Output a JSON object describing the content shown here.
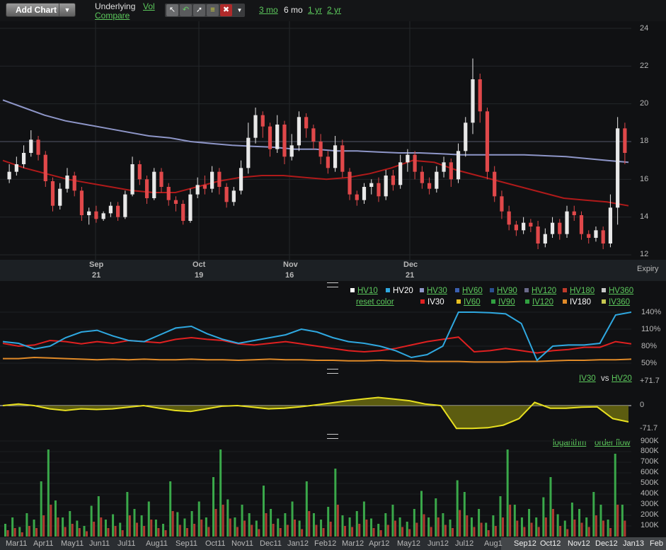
{
  "toolbar": {
    "add_chart": "Add Chart",
    "underlying": "Underlying",
    "vol": "Vol",
    "compare": "Compare",
    "ranges": [
      "3 mo",
      "6 mo",
      "1 yr",
      "2 yr"
    ],
    "active_range": "6 mo",
    "tools": [
      "pointer-icon",
      "undo-icon",
      "line-draw-icon",
      "studies-icon",
      "delete-icon",
      "dropdown-icon"
    ]
  },
  "colors": {
    "up": "#e8e8e8",
    "down": "#e0484a",
    "ma_long": "#8e96c8",
    "ma_short": "#b01a1a",
    "hv20": "#2fa8e0",
    "iv30": "#e02020",
    "iv180": "#e08a28",
    "spread": "#e8e020",
    "vol_green": "#3aa84a",
    "vol_red": "#b03a30",
    "link": "#5cc85c"
  },
  "price_panel": {
    "y_ticks": [
      "24",
      "22",
      "20",
      "18",
      "16",
      "14",
      "12"
    ],
    "months": [
      {
        "m": "Sep",
        "d": "21"
      },
      {
        "m": "Oct",
        "d": "19"
      },
      {
        "m": "Nov",
        "d": "16"
      },
      {
        "m": "Dec",
        "d": "21"
      }
    ],
    "expiry_label": "Expiry"
  },
  "vol_panel": {
    "legend_row1": [
      {
        "label": "HV10",
        "color": "#ffffff",
        "active": false
      },
      {
        "label": "HV20",
        "color": "#2fa8e0",
        "active": true
      },
      {
        "label": "HV30",
        "color": "#8e96c8",
        "active": false
      },
      {
        "label": "HV60",
        "color": "#3a5fb0",
        "active": false
      },
      {
        "label": "HV90",
        "color": "#2a4f90",
        "active": false
      },
      {
        "label": "HV120",
        "color": "#6a6a8a",
        "active": false
      },
      {
        "label": "HV180",
        "color": "#c03a2a",
        "active": false
      },
      {
        "label": "HV360",
        "color": "#c8c8c8",
        "active": false
      }
    ],
    "legend_row2": [
      {
        "label": "reset color",
        "color": "",
        "active": false
      },
      {
        "label": "IV30",
        "color": "#e02020",
        "active": true
      },
      {
        "label": "IV60",
        "color": "#e8c020",
        "active": false
      },
      {
        "label": "IV90",
        "color": "#30a040",
        "active": false
      },
      {
        "label": "IV120",
        "color": "#30a040",
        "active": false
      },
      {
        "label": "IV180",
        "color": "#e08a28",
        "active": true
      },
      {
        "label": "IV360",
        "color": "#c8c850",
        "active": false
      }
    ],
    "y_ticks": [
      "140%",
      "110%",
      "80%",
      "50%"
    ]
  },
  "spread_panel": {
    "legend_a": "IV30",
    "legend_vs": "vs",
    "legend_b": "HV20",
    "y_ticks": [
      "+71.7",
      "0",
      "-71.7"
    ]
  },
  "volume_panel": {
    "links": [
      "logarithm",
      "order flow"
    ],
    "y_ticks": [
      "900K",
      "800K",
      "700K",
      "600K",
      "500K",
      "400K",
      "300K",
      "200K",
      "100K"
    ]
  },
  "bottom_axis": {
    "labels": [
      "Mar11",
      "Apr11",
      "May11",
      "Jun11",
      "Jul11",
      "Aug11",
      "Sep11",
      "Oct11",
      "Nov11",
      "Dec11",
      "Jan12",
      "Feb12",
      "Mar12",
      "Apr12",
      "May12",
      "Jun12",
      "Jul12",
      "Aug1",
      "Sep12",
      "Oct12",
      "Nov12",
      "Dec12",
      "Jan13",
      "Feb"
    ]
  },
  "chart_data": {
    "type": "candlestick",
    "y_range": [
      12,
      24
    ],
    "ma_long": [
      20.2,
      19.8,
      19.4,
      19.1,
      18.9,
      18.7,
      18.5,
      18.3,
      18.2,
      18.0,
      17.9,
      17.8,
      17.75,
      17.7,
      17.6,
      17.6,
      17.5,
      17.5,
      17.45,
      17.4,
      17.4,
      17.35,
      17.3,
      17.3,
      17.3,
      17.3,
      17.25,
      17.2,
      17.1,
      17.0,
      16.9
    ],
    "ma_short": [
      17.0,
      16.6,
      16.3,
      16.0,
      15.8,
      15.6,
      15.4,
      15.3,
      15.3,
      15.6,
      15.9,
      16.1,
      16.2,
      16.2,
      16.1,
      16.0,
      16.1,
      16.3,
      16.6,
      17.0,
      16.9,
      16.5,
      16.2,
      15.9,
      15.6,
      15.3,
      15.0,
      14.9,
      14.8,
      14.6
    ],
    "candles": [
      [
        16.0,
        16.4,
        15.8,
        16.8
      ],
      [
        16.4,
        16.8,
        16.2,
        17.2
      ],
      [
        16.8,
        17.4,
        16.6,
        17.8
      ],
      [
        17.4,
        18.1,
        17.2,
        18.6
      ],
      [
        18.1,
        17.3,
        17.0,
        18.3
      ],
      [
        17.3,
        15.9,
        15.6,
        17.5
      ],
      [
        15.9,
        14.6,
        14.3,
        16.1
      ],
      [
        14.6,
        15.5,
        14.4,
        15.8
      ],
      [
        15.5,
        16.2,
        15.3,
        16.6
      ],
      [
        16.2,
        15.4,
        15.1,
        16.4
      ],
      [
        15.4,
        14.1,
        13.8,
        15.6
      ],
      [
        14.1,
        14.3,
        13.6,
        14.5
      ],
      [
        14.3,
        13.9,
        13.7,
        14.6
      ],
      [
        13.9,
        14.2,
        13.8,
        14.3
      ],
      [
        14.2,
        14.6,
        14.0,
        14.8
      ],
      [
        14.6,
        14.0,
        13.8,
        14.8
      ],
      [
        14.0,
        15.2,
        13.9,
        15.4
      ],
      [
        15.2,
        16.8,
        15.1,
        17.2
      ],
      [
        16.8,
        16.0,
        15.7,
        17.0
      ],
      [
        16.0,
        15.0,
        14.7,
        16.2
      ],
      [
        15.0,
        16.4,
        14.9,
        16.6
      ],
      [
        16.4,
        15.6,
        15.3,
        16.6
      ],
      [
        15.6,
        14.9,
        14.6,
        15.8
      ],
      [
        14.9,
        14.7,
        14.3,
        15.1
      ],
      [
        14.7,
        13.8,
        13.6,
        14.9
      ],
      [
        13.8,
        15.2,
        13.7,
        15.5
      ],
      [
        15.2,
        15.7,
        15.0,
        16.1
      ],
      [
        15.7,
        15.5,
        15.2,
        16.2
      ],
      [
        15.5,
        16.4,
        15.3,
        16.7
      ],
      [
        16.4,
        15.6,
        15.2,
        16.6
      ],
      [
        15.6,
        14.8,
        14.5,
        15.8
      ],
      [
        14.8,
        15.4,
        14.6,
        15.6
      ],
      [
        15.4,
        16.6,
        15.2,
        17.0
      ],
      [
        16.6,
        18.2,
        16.3,
        19.0
      ],
      [
        18.2,
        19.4,
        17.9,
        19.8
      ],
      [
        19.4,
        18.8,
        18.2,
        19.6
      ],
      [
        18.8,
        17.6,
        17.2,
        19.0
      ],
      [
        17.6,
        18.9,
        17.4,
        19.4
      ],
      [
        18.9,
        17.2,
        16.8,
        19.1
      ],
      [
        17.2,
        17.8,
        17.0,
        18.4
      ],
      [
        17.8,
        19.3,
        17.5,
        19.6
      ],
      [
        19.3,
        18.7,
        18.2,
        19.5
      ],
      [
        18.7,
        18.0,
        17.6,
        18.9
      ],
      [
        18.0,
        17.2,
        16.8,
        18.4
      ],
      [
        17.2,
        16.6,
        16.3,
        17.5
      ],
      [
        16.6,
        17.8,
        16.4,
        18.3
      ],
      [
        17.8,
        16.4,
        16.1,
        18.1
      ],
      [
        16.4,
        15.2,
        14.9,
        16.6
      ],
      [
        15.2,
        14.9,
        14.6,
        15.4
      ],
      [
        14.9,
        15.6,
        14.7,
        15.8
      ],
      [
        15.6,
        15.8,
        15.2,
        16.0
      ],
      [
        15.8,
        15.1,
        14.8,
        16.1
      ],
      [
        15.1,
        16.2,
        14.9,
        16.5
      ],
      [
        16.2,
        15.7,
        15.4,
        16.5
      ],
      [
        15.7,
        16.9,
        15.5,
        17.3
      ],
      [
        16.9,
        17.3,
        16.4,
        17.6
      ],
      [
        17.3,
        16.4,
        16.0,
        17.5
      ],
      [
        16.4,
        15.8,
        15.5,
        16.7
      ],
      [
        15.8,
        15.5,
        15.2,
        16.1
      ],
      [
        15.5,
        16.4,
        15.3,
        16.7
      ],
      [
        16.4,
        16.9,
        16.1,
        17.2
      ],
      [
        16.9,
        16.0,
        15.6,
        17.1
      ],
      [
        16.0,
        17.5,
        15.8,
        17.9
      ],
      [
        17.5,
        19.0,
        17.2,
        19.3
      ],
      [
        19.0,
        21.3,
        18.4,
        22.4
      ],
      [
        21.3,
        19.6,
        19.0,
        21.6
      ],
      [
        19.6,
        16.4,
        16.0,
        19.8
      ],
      [
        16.4,
        15.1,
        14.8,
        16.7
      ],
      [
        15.1,
        14.3,
        13.9,
        15.4
      ],
      [
        14.3,
        13.6,
        13.3,
        14.6
      ],
      [
        13.6,
        13.3,
        13.0,
        13.8
      ],
      [
        13.3,
        13.7,
        13.1,
        14.0
      ],
      [
        13.7,
        13.5,
        13.2,
        13.9
      ],
      [
        13.5,
        12.6,
        12.3,
        13.8
      ],
      [
        12.6,
        13.1,
        12.4,
        13.4
      ],
      [
        13.1,
        13.7,
        12.9,
        14.0
      ],
      [
        13.7,
        13.1,
        12.8,
        13.9
      ],
      [
        13.1,
        14.3,
        12.9,
        14.6
      ],
      [
        14.3,
        14.1,
        13.8,
        14.6
      ],
      [
        14.1,
        13.1,
        12.8,
        14.3
      ],
      [
        13.1,
        12.9,
        12.6,
        13.3
      ],
      [
        12.9,
        13.3,
        12.7,
        13.5
      ],
      [
        13.3,
        12.6,
        12.3,
        13.5
      ],
      [
        12.6,
        14.5,
        12.4,
        15.2
      ],
      [
        14.5,
        18.7,
        13.6,
        19.3
      ],
      [
        18.7,
        17.4,
        16.8,
        19.0
      ]
    ],
    "vol_hv20": [
      88,
      85,
      75,
      80,
      95,
      105,
      108,
      98,
      90,
      88,
      100,
      112,
      115,
      102,
      92,
      85,
      90,
      95,
      100,
      110,
      105,
      95,
      88,
      85,
      80,
      72,
      60,
      65,
      80,
      140,
      140,
      139,
      137,
      120,
      55,
      80,
      82,
      82,
      85,
      135,
      140
    ],
    "vol_iv30": [
      85,
      80,
      82,
      90,
      88,
      84,
      88,
      85,
      90,
      88,
      86,
      92,
      95,
      92,
      90,
      84,
      82,
      85,
      88,
      84,
      80,
      76,
      72,
      70,
      72,
      76,
      82,
      88,
      92,
      96,
      70,
      72,
      76,
      72,
      68,
      72,
      74,
      78,
      78,
      88,
      84
    ],
    "vol_iv180": [
      58,
      58,
      60,
      59,
      58,
      57,
      56,
      57,
      56,
      57,
      56,
      56,
      57,
      56,
      56,
      55,
      56,
      57,
      56,
      56,
      55,
      55,
      54,
      54,
      55,
      54,
      54,
      53,
      53,
      53,
      52,
      52,
      52,
      53,
      53,
      54,
      55,
      55,
      56,
      56,
      57
    ],
    "spread": [
      0,
      5,
      0,
      -10,
      -15,
      -10,
      -12,
      -10,
      -5,
      0,
      -8,
      -15,
      -18,
      -10,
      -2,
      0,
      -5,
      -10,
      -8,
      -4,
      2,
      8,
      15,
      20,
      25,
      20,
      15,
      5,
      0,
      -70,
      -70,
      -68,
      -60,
      -40,
      10,
      -8,
      -8,
      -5,
      -4,
      -40,
      -50
    ],
    "volume_green": [
      120,
      180,
      90,
      220,
      160,
      520,
      820,
      340,
      180,
      240,
      150,
      100,
      290,
      380,
      160,
      210,
      130,
      420,
      260,
      200,
      330,
      160,
      120,
      520,
      230,
      170,
      240,
      330,
      180,
      560,
      820,
      350,
      180,
      300,
      220,
      150,
      480,
      260,
      170,
      220,
      330,
      150,
      520,
      220,
      160,
      280,
      640,
      200,
      180,
      240,
      330,
      170,
      120,
      220,
      300,
      180,
      140,
      260,
      430,
      180,
      360,
      220,
      160,
      530,
      420,
      180,
      260,
      130,
      200,
      380,
      820,
      300,
      180,
      260,
      180,
      370,
      560,
      210,
      150,
      320,
      260,
      180,
      420,
      300,
      160,
      780,
      300
    ],
    "volume_red": [
      60,
      80,
      40,
      100,
      80,
      200,
      300,
      180,
      90,
      120,
      80,
      50,
      140,
      180,
      80,
      100,
      60,
      200,
      130,
      100,
      160,
      80,
      60,
      240,
      110,
      80,
      120,
      160,
      90,
      260,
      300,
      170,
      90,
      150,
      110,
      70,
      220,
      120,
      80,
      110,
      160,
      70,
      240,
      110,
      80,
      140,
      300,
      100,
      90,
      120,
      160,
      80,
      60,
      110,
      150,
      90,
      70,
      130,
      210,
      90,
      180,
      110,
      80,
      250,
      200,
      90,
      130,
      60,
      100,
      180,
      300,
      150,
      90,
      130,
      90,
      180,
      260,
      100,
      70,
      160,
      130,
      90,
      200,
      150,
      80,
      300,
      150
    ],
    "volume_y_range": [
      0,
      900
    ]
  }
}
